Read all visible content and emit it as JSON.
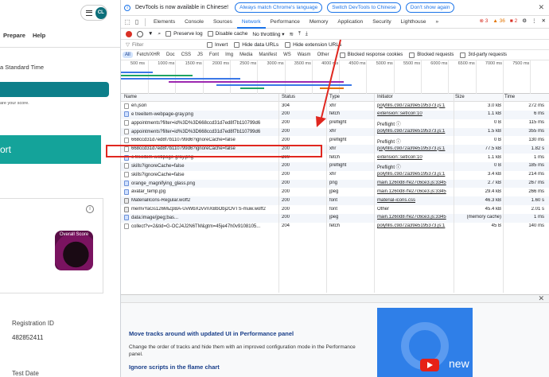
{
  "page": {
    "avatar_initials": "CL",
    "nav": [
      "Prepare",
      "Help"
    ],
    "timezone_text": "a Standard Time",
    "score_note": "are your score.",
    "teal_button_label": "ort",
    "score_image_label": "Overall Score",
    "info_icon": "i",
    "registration_label": "Registration ID",
    "registration_value": "482852411",
    "test_date_label": "Test Date"
  },
  "devtools": {
    "infobar": {
      "message": "DevTools is now available in Chinese!",
      "buttons": [
        "Always match Chrome's language",
        "Switch DevTools to Chinese",
        "Don't show again"
      ]
    },
    "tabs": [
      "Elements",
      "Console",
      "Sources",
      "Network",
      "Performance",
      "Memory",
      "Application",
      "Security",
      "Lighthouse"
    ],
    "active_tab": "Network",
    "more_tabs": "»",
    "badges": {
      "errors": "3",
      "warnings": "36",
      "info": "2"
    },
    "toolbar": {
      "preserve_log": "Preserve log",
      "disable_cache": "Disable cache",
      "throttle": "No throttling"
    },
    "filter": {
      "placeholder": "Filter",
      "invert": "Invert",
      "hide_data_urls": "Hide data URLs",
      "hide_extension_urls": "Hide extension URLs"
    },
    "type_filters": [
      "All",
      "Fetch/XHR",
      "Doc",
      "CSS",
      "JS",
      "Font",
      "Img",
      "Media",
      "Manifest",
      "WS",
      "Wasm",
      "Other"
    ],
    "active_type_filter": "All",
    "type_options": {
      "blocked_cookies": "Blocked response cookies",
      "blocked_requests": "Blocked requests",
      "third_party": "3rd-party requests"
    },
    "ticks": [
      "500 ms",
      "1000 ms",
      "1500 ms",
      "2000 ms",
      "2500 ms",
      "3000 ms",
      "3500 ms",
      "4000 ms",
      "4500 ms",
      "5000 ms",
      "5500 ms",
      "6000 ms",
      "6500 ms",
      "7000 ms",
      "7500 ms"
    ],
    "columns": {
      "name": "Name",
      "status": "Status",
      "type": "Type",
      "initiator": "Initiator",
      "size": "Size",
      "time": "Time"
    },
    "rows": [
      {
        "name": "en.json",
        "icon": "xhr",
        "status": "304",
        "type": "xhr",
        "initiator": "polyfills.c9d72a39e5195373.js:1",
        "size": "3.0 kB",
        "time": "272 ms"
      },
      {
        "name": "e treeitem-webpage-gray.png",
        "icon": "img",
        "status": "200",
        "type": "fetch",
        "initiator": "extension::setIcon:10",
        "size": "1.1 kB",
        "time": "6 ms"
      },
      {
        "name": "appointments?filter=id%3D%3D668ccd31d7ed8f7b110799d6",
        "icon": "xhr",
        "status": "200",
        "type": "preflight",
        "initiator": "Preflight ⓘ",
        "initiator_plain": true,
        "size": "0 B",
        "time": "115 ms"
      },
      {
        "name": "appointments?filter=id%3D%3D668ccd31d7ed8f7b110799d6",
        "icon": "xhr",
        "status": "200",
        "type": "xhr",
        "initiator": "polyfills.c9d72a39e5195373.js:1",
        "size": "1.5 kB",
        "time": "355 ms"
      },
      {
        "name": "668ccd31d7ed8f7b110799d6?ignoreCache=false",
        "icon": "xhr",
        "status": "200",
        "type": "preflight",
        "initiator": "Preflight ⓘ",
        "initiator_plain": true,
        "size": "0 B",
        "time": "130 ms"
      },
      {
        "name": "668ccd31d7ed8f7b110799d6?ignoreCache=false",
        "icon": "xhr",
        "status": "200",
        "type": "xhr",
        "initiator": "polyfills.c9d72a39e5195373.js:1",
        "size": "77.5 kB",
        "time": "1.82 s"
      },
      {
        "name": "e treeitem-webpage-gray.png",
        "icon": "img",
        "status": "200",
        "type": "fetch",
        "initiator": "extension::setIcon:10",
        "size": "1.1 kB",
        "time": "1 ms"
      },
      {
        "name": "skills?ignoreCache=false",
        "icon": "xhr",
        "status": "200",
        "type": "preflight",
        "initiator": "Preflight ⓘ",
        "initiator_plain": true,
        "size": "0 B",
        "time": "185 ms"
      },
      {
        "name": "skills?ignoreCache=false",
        "icon": "xhr",
        "status": "200",
        "type": "xhr",
        "initiator": "polyfills.c9d72a39e5195373.js:1",
        "size": "3.4 kB",
        "time": "214 ms"
      },
      {
        "name": "orange_magnifying_glass.png",
        "icon": "img",
        "status": "200",
        "type": "png",
        "initiator": "main.1260d87fe27c6ce3.js:3345",
        "size": "2.7 kB",
        "time": "267 ms"
      },
      {
        "name": "avatar_temp.jpg",
        "icon": "img",
        "status": "200",
        "type": "jpeg",
        "initiator": "main.1260d87fe27c6ce3.js:3345",
        "size": "29.4 kB",
        "time": "266 ms"
      },
      {
        "name": "MaterialIcons-Regular.woff2",
        "icon": "font",
        "status": "200",
        "type": "font",
        "initiator": "material-icons.css",
        "size": "46.3 kB",
        "time": "1.60 s"
      },
      {
        "name": "memvYaGs126MiZpBA-UvWbX2vVnXBbObj2OVTS-muw.woff2",
        "icon": "font",
        "status": "200",
        "type": "font",
        "initiator": "Other",
        "initiator_plain": true,
        "size": "45.4 kB",
        "time": "2.01 s"
      },
      {
        "name": "data:image/jpeg;bas...",
        "icon": "img",
        "status": "200",
        "type": "jpeg",
        "initiator": "main.1260d87fe27c6ce3.js:3345",
        "size": "(memory cache)",
        "time": "1 ms"
      },
      {
        "name": "collect?v=2&tid=G-OCJ4J2N6TM&gtm=45je47h0v9108105...",
        "icon": "xhr",
        "status": "204",
        "type": "fetch",
        "initiator": "polyfills.c9d72a39e5195373.js:1",
        "size": "45 B",
        "time": "140 ms"
      }
    ],
    "drawer": {
      "title1": "Move tracks around with updated UI in Performance panel",
      "body1": "Change the order of tracks and hide them with an improved configuration mode in the Performance panel.",
      "title2": "Ignore scripts in the flame chart",
      "video_text": "new"
    }
  }
}
